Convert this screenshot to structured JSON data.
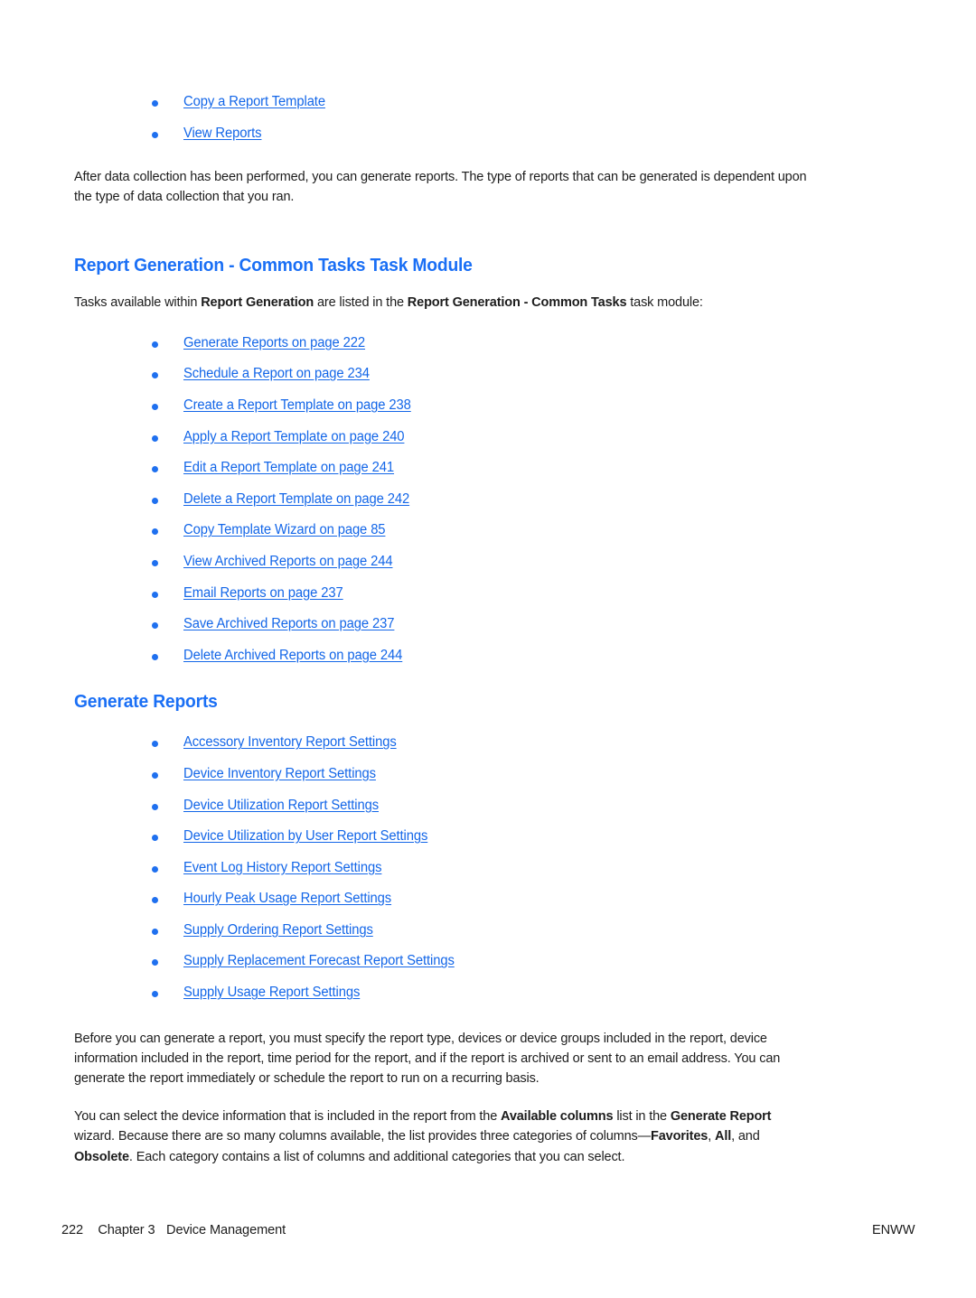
{
  "document": {
    "type": "user-guide-page",
    "link_color": "#1366e8",
    "heading_color": "#1a6ff5",
    "text_color": "#1c1c1c",
    "bullet_color": "#1f70ef"
  },
  "top_list": {
    "items": [
      {
        "label": "Copy a Report Template"
      },
      {
        "label": "View Reports"
      }
    ]
  },
  "intro_paragraph": {
    "text": "After data collection has been performed, you can generate reports. The type of reports that can be generated is dependent upon the type of data collection that you ran."
  },
  "section_one": {
    "heading": "Report Generation - Common Tasks Task Module",
    "intro": {
      "part1": "Tasks available within ",
      "bold1": "Report Generation",
      "part2": " are listed in the ",
      "bold2": "Report Generation - Common Tasks",
      "part3": " task module:"
    },
    "items": [
      {
        "label": "Generate Reports on page 222"
      },
      {
        "label": "Schedule a Report on page 234"
      },
      {
        "label": "Create a Report Template on page 238"
      },
      {
        "label": "Apply a Report Template on page 240"
      },
      {
        "label": "Edit a Report Template on page 241"
      },
      {
        "label": "Delete a Report Template on page 242"
      },
      {
        "label": "Copy Template Wizard on page 85"
      },
      {
        "label": "View Archived Reports on page 244"
      },
      {
        "label": "Email Reports on page 237"
      },
      {
        "label": "Save Archived Reports on page 237"
      },
      {
        "label": "Delete Archived Reports on page 244"
      }
    ]
  },
  "section_two": {
    "heading": "Generate Reports",
    "items": [
      {
        "label": "Accessory Inventory Report Settings"
      },
      {
        "label": "Device Inventory Report Settings"
      },
      {
        "label": "Device Utilization Report Settings"
      },
      {
        "label": "Device Utilization by User Report Settings"
      },
      {
        "label": "Event Log History Report Settings"
      },
      {
        "label": "Hourly Peak Usage Report Settings"
      },
      {
        "label": "Supply Ordering Report Settings"
      },
      {
        "label": "Supply Replacement Forecast Report Settings"
      },
      {
        "label": "Supply Usage Report Settings"
      }
    ],
    "paragraph_one": {
      "text": "Before you can generate a report, you must specify the report type, devices or device groups included in the report, device information included in the report, time period for the report, and if the report is archived or sent to an email address. You can generate the report immediately or schedule the report to run on a recurring basis."
    },
    "paragraph_two": {
      "part1": "You can select the device information that is included in the report from the ",
      "bold1": "Available columns",
      "part2": " list in the ",
      "bold2": "Generate Report",
      "part3": " wizard. Because there are so many columns available, the list provides three categories of columns—",
      "bold3": "Favorites",
      "part4": ", ",
      "bold4": "All",
      "part5": ", and ",
      "bold5": "Obsolete",
      "part6": ". Each category contains a list of columns and additional categories that you can select."
    }
  },
  "footer": {
    "page_number": "222",
    "chapter": "Chapter 3",
    "chapter_title": "Device Management",
    "locale": "ENWW"
  }
}
